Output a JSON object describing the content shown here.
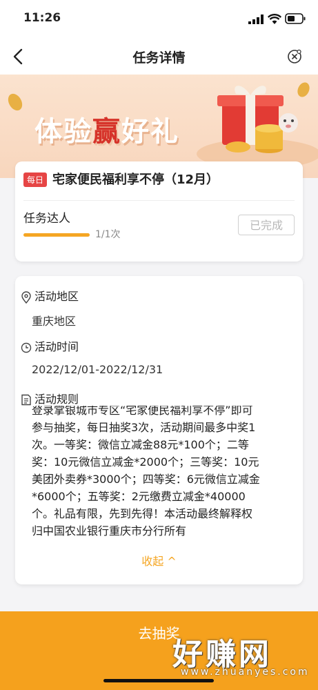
{
  "status": {
    "time": "11:26"
  },
  "nav": {
    "title": "任务详情"
  },
  "banner": {
    "title_pre": "体验",
    "title_hl": "赢",
    "title_post": "好礼"
  },
  "task": {
    "badge": "每日",
    "title": "宅家便民福利享不停（12月）",
    "name": "任务达人",
    "progress_text": "1/1次",
    "progress_fraction": 1.0,
    "status_label": "已完成"
  },
  "details": {
    "region_label": "活动地区",
    "region_value": "重庆地区",
    "time_label": "活动时间",
    "time_value": "2022/12/01-2022/12/31",
    "rules_label": "活动规则",
    "rules_lines": [
      "登录掌银城市专区“宅家便民福利享不停”即可",
      "参与抽奖，每日抽奖3次，活动期间最多中奖1",
      "次。一等奖：微信立减金88元*100个；二等",
      "奖：10元微信立减金*2000个；三等奖：10元",
      "美团外卖券*3000个；四等奖：6元微信立减金",
      "*6000个；五等奖：2元缴费立减金*40000",
      "个。礼品有限，先到先得！本活动最终解释权",
      "归中国农业银行重庆市分行所有"
    ],
    "collapse_label": "收起 ^"
  },
  "bottom": {
    "button_label": "去抽奖"
  },
  "watermark": {
    "main": "好赚网",
    "sub": "www.zhuanyes.com"
  },
  "colors": {
    "accent": "#f5a623",
    "badge": "#e64545",
    "bottom_bar": "#f5a11d"
  }
}
